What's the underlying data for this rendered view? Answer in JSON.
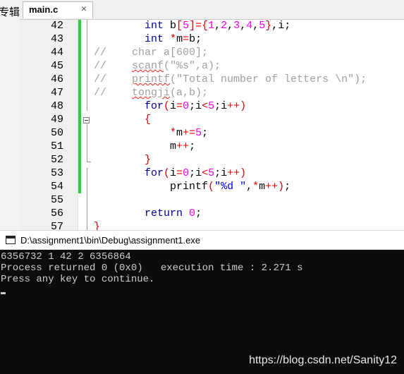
{
  "left_panel": {
    "cut_text": "专辑"
  },
  "tab": {
    "name": "main.c",
    "close": "×"
  },
  "lines": [
    {
      "n": "42",
      "segs": [
        [
          "sp",
          "        "
        ],
        [
          "kw",
          "int"
        ],
        [
          "pl",
          " b"
        ],
        [
          "op",
          "["
        ],
        [
          "num",
          "5"
        ],
        [
          "op",
          "]"
        ],
        [
          "op",
          "={"
        ],
        [
          "num",
          "1"
        ],
        [
          "pl",
          ","
        ],
        [
          "num",
          "2"
        ],
        [
          "pl",
          ","
        ],
        [
          "num",
          "3"
        ],
        [
          "pl",
          ","
        ],
        [
          "num",
          "4"
        ],
        [
          "pl",
          ","
        ],
        [
          "num",
          "5"
        ],
        [
          "op",
          "}"
        ],
        [
          "pl",
          ",i;"
        ]
      ]
    },
    {
      "n": "43",
      "segs": [
        [
          "sp",
          "        "
        ],
        [
          "kw",
          "int"
        ],
        [
          "pl",
          " "
        ],
        [
          "op",
          "*"
        ],
        [
          "pl",
          "m"
        ],
        [
          "op",
          "="
        ],
        [
          "pl",
          "b;"
        ]
      ]
    },
    {
      "n": "44",
      "segs": [
        [
          "cmt",
          "//    char a[600];"
        ]
      ]
    },
    {
      "n": "45",
      "segs": [
        [
          "cmt",
          "//    "
        ],
        [
          "cmtsq",
          "scanf"
        ],
        [
          "cmt",
          "(\"%s\",a);"
        ]
      ]
    },
    {
      "n": "46",
      "segs": [
        [
          "cmt",
          "//    "
        ],
        [
          "cmtsq",
          "printf"
        ],
        [
          "cmt",
          "(\"Total number of letters \\n\");"
        ]
      ]
    },
    {
      "n": "47",
      "segs": [
        [
          "cmt",
          "//    "
        ],
        [
          "cmtsq",
          "tongji"
        ],
        [
          "cmt",
          "(a,b);"
        ]
      ]
    },
    {
      "n": "48",
      "segs": [
        [
          "sp",
          "        "
        ],
        [
          "kw",
          "for"
        ],
        [
          "op",
          "("
        ],
        [
          "pl",
          "i"
        ],
        [
          "op",
          "="
        ],
        [
          "num",
          "0"
        ],
        [
          "pl",
          ";i"
        ],
        [
          "op",
          "<"
        ],
        [
          "num",
          "5"
        ],
        [
          "pl",
          ";i"
        ],
        [
          "op",
          "++)"
        ]
      ]
    },
    {
      "n": "49",
      "segs": [
        [
          "sp",
          "        "
        ],
        [
          "op",
          "{"
        ]
      ]
    },
    {
      "n": "50",
      "segs": [
        [
          "sp",
          "            "
        ],
        [
          "op",
          "*"
        ],
        [
          "pl",
          "m"
        ],
        [
          "op",
          "+="
        ],
        [
          "num",
          "5"
        ],
        [
          "pl",
          ";"
        ]
      ]
    },
    {
      "n": "51",
      "segs": [
        [
          "sp",
          "            "
        ],
        [
          "pl",
          "m"
        ],
        [
          "op",
          "++"
        ],
        [
          "pl",
          ";"
        ]
      ]
    },
    {
      "n": "52",
      "segs": [
        [
          "sp",
          "        "
        ],
        [
          "op",
          "}"
        ]
      ]
    },
    {
      "n": "53",
      "segs": [
        [
          "sp",
          "        "
        ],
        [
          "kw",
          "for"
        ],
        [
          "op",
          "("
        ],
        [
          "pl",
          "i"
        ],
        [
          "op",
          "="
        ],
        [
          "num",
          "0"
        ],
        [
          "pl",
          ";i"
        ],
        [
          "op",
          "<"
        ],
        [
          "num",
          "5"
        ],
        [
          "pl",
          ";i"
        ],
        [
          "op",
          "++)"
        ]
      ]
    },
    {
      "n": "54",
      "segs": [
        [
          "sp",
          "            "
        ],
        [
          "pl",
          "printf"
        ],
        [
          "op",
          "("
        ],
        [
          "str",
          "\"%d \""
        ],
        [
          "pl",
          ","
        ],
        [
          "op",
          "*"
        ],
        [
          "pl",
          "m"
        ],
        [
          "op",
          "++"
        ],
        [
          "op",
          ")"
        ],
        [
          "pl",
          ";"
        ]
      ]
    },
    {
      "n": "55",
      "segs": []
    },
    {
      "n": "56",
      "segs": [
        [
          "sp",
          "        "
        ],
        [
          "kw",
          "return"
        ],
        [
          "pl",
          " "
        ],
        [
          "num",
          "0"
        ],
        [
          "pl",
          ";"
        ]
      ]
    },
    {
      "n": "57",
      "segs": [
        [
          "op",
          "}"
        ]
      ]
    }
  ],
  "console": {
    "title": "D:\\assignment1\\bin\\Debug\\assignment1.exe",
    "lines": [
      "6356732 1 42 2 6356864",
      "Process returned 0 (0x0)   execution time : 2.271 s",
      "Press any key to continue."
    ],
    "watermark": "https://blog.csdn.net/Sanity12"
  },
  "colors": {
    "keyword": "#0000a0",
    "number": "#f000f0",
    "operator": "#e00000",
    "string": "#0000ff",
    "comment": "#a0a0a0",
    "changebar": "#2ecc40"
  }
}
